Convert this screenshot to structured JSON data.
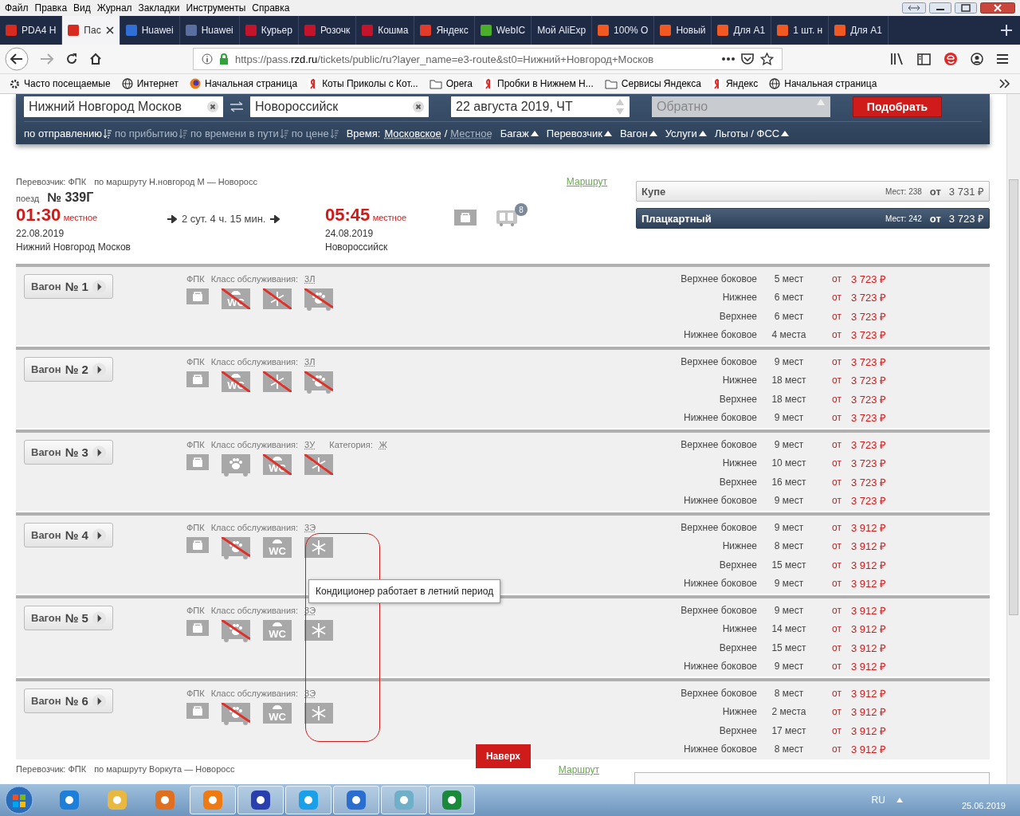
{
  "menu_bar": [
    "Файл",
    "Правка",
    "Вид",
    "Журнал",
    "Закладки",
    "Инструменты",
    "Справка"
  ],
  "tabs": [
    {
      "title": "PDA4 H",
      "selected": false,
      "color": "#d62b1e"
    },
    {
      "title": "Пас",
      "selected": true,
      "color": "#d62b1e"
    },
    {
      "title": "Huawei",
      "selected": false,
      "color": "#2f6fd6"
    },
    {
      "title": "Huawei",
      "selected": false,
      "color": "#5a6fa0"
    },
    {
      "title": "Курьер",
      "selected": false,
      "color": "#c4142b"
    },
    {
      "title": "Розочк",
      "selected": false,
      "color": "#c4142b"
    },
    {
      "title": "Кошма",
      "selected": false,
      "color": "#c4142b"
    },
    {
      "title": "Яндекс",
      "selected": false,
      "color": "#e23b2a"
    },
    {
      "title": "WebIC",
      "selected": false,
      "color": "#4caf2a"
    },
    {
      "title": "Мой AliExp",
      "selected": false
    },
    {
      "title": "100% O",
      "selected": false,
      "color": "#f05a22"
    },
    {
      "title": "Новый",
      "selected": false,
      "color": "#f05a22"
    },
    {
      "title": "Для A1",
      "selected": false,
      "color": "#f05a22"
    },
    {
      "title": "1 шт. н",
      "selected": false,
      "color": "#f05a22"
    },
    {
      "title": "Для A1",
      "selected": false,
      "color": "#f05a22"
    }
  ],
  "address": {
    "url_host": "https://pass.",
    "url_domain": "rzd.ru",
    "url_rest": "/tickets/public/ru?layer_name=e3-route&st0=Нижний+Новгород+Москов"
  },
  "bookmarks": [
    {
      "kind": "gear",
      "label": "Часто посещаемые"
    },
    {
      "kind": "globe",
      "label": "Интернет"
    },
    {
      "kind": "fox",
      "label": "Начальная страница"
    },
    {
      "kind": "ya",
      "label": "Коты Приколы с Кот..."
    },
    {
      "kind": "folder",
      "label": "Opera"
    },
    {
      "kind": "ya",
      "label": "Пробки в Нижнем Н..."
    },
    {
      "kind": "folder",
      "label": "Сервисы Яндекса"
    },
    {
      "kind": "ya",
      "label": "Яндекс"
    },
    {
      "kind": "globe",
      "label": "Начальная страница"
    }
  ],
  "search": {
    "from": "Нижний Новгород Москов",
    "to": "Новороссийск",
    "date": "22 августа 2019, ЧТ",
    "return_placeholder": "Обратно",
    "submit": "Подобрать"
  },
  "sort_options": [
    {
      "label": "по отправлению",
      "selected": true
    },
    {
      "label": "по прибытию",
      "selected": false
    },
    {
      "label": "по времени в пути",
      "selected": false
    },
    {
      "label": "по цене",
      "selected": false
    }
  ],
  "time_label": "Время:",
  "time_options": [
    {
      "label": "Московское",
      "selected": true
    },
    {
      "label": "Местное",
      "selected": false
    }
  ],
  "time_separator": "/",
  "filters": [
    "Багаж",
    "Перевозчик",
    "Вагон",
    "Услуги",
    "Льготы / ФСС"
  ],
  "train": {
    "carrier": "Перевозчик: ФПК",
    "route": "по маршруту Н.новгород М — Новоросс",
    "route_link": "Маршрут",
    "train_label": "поезд",
    "number": "№ 339Г",
    "departure": {
      "time": "01:30",
      "zone": "местное",
      "date": "22.08.2019",
      "station": "Нижний Новгород Москов"
    },
    "duration": "2 сут. 4 ч. 15 мин.",
    "arrival": {
      "time": "05:45",
      "zone": "местное",
      "date": "24.08.2019",
      "station": "Новороссийск"
    },
    "wagons_badge": "8",
    "classes": [
      {
        "name": "Купе",
        "seats": "Мест: 238",
        "from": "от",
        "price": "3 731 ₽",
        "selected": false
      },
      {
        "name": "Плацкартный",
        "seats": "Мест: 242",
        "from": "от",
        "price": "3 723 ₽",
        "selected": true
      }
    ]
  },
  "wagons": [
    {
      "label": "Вагон",
      "number": "№ 1",
      "carrier": "ФПК",
      "class_label": "Класс обслуживания:",
      "class_value": "3Л",
      "amenities": [
        {
          "kind": "baggage",
          "crossed": false
        },
        {
          "kind": "wc",
          "label": "WC",
          "crossed": true
        },
        {
          "kind": "snow",
          "crossed": true
        },
        {
          "kind": "pet",
          "crossed": true
        }
      ],
      "seats": [
        {
          "type": "Верхнее боковое",
          "count": "5 мест",
          "from": "от",
          "price": "3 723 ₽"
        },
        {
          "type": "Нижнее",
          "count": "6 мест",
          "from": "от",
          "price": "3 723 ₽"
        },
        {
          "type": "Верхнее",
          "count": "6 мест",
          "from": "от",
          "price": "3 723 ₽"
        },
        {
          "type": "Нижнее боковое",
          "count": "4 места",
          "from": "от",
          "price": "3 723 ₽"
        }
      ]
    },
    {
      "label": "Вагон",
      "number": "№ 2",
      "carrier": "ФПК",
      "class_label": "Класс обслуживания:",
      "class_value": "3Л",
      "amenities": [
        {
          "kind": "baggage",
          "crossed": false
        },
        {
          "kind": "wc",
          "label": "WC",
          "crossed": true
        },
        {
          "kind": "snow",
          "crossed": true
        },
        {
          "kind": "pet",
          "crossed": true
        }
      ],
      "seats": [
        {
          "type": "Верхнее боковое",
          "count": "9 мест",
          "from": "от",
          "price": "3 723 ₽"
        },
        {
          "type": "Нижнее",
          "count": "18 мест",
          "from": "от",
          "price": "3 723 ₽"
        },
        {
          "type": "Верхнее",
          "count": "18 мест",
          "from": "от",
          "price": "3 723 ₽"
        },
        {
          "type": "Нижнее боковое",
          "count": "9 мест",
          "from": "от",
          "price": "3 723 ₽"
        }
      ]
    },
    {
      "label": "Вагон",
      "number": "№ 3",
      "carrier": "ФПК",
      "class_label": "Класс обслуживания:",
      "class_value": "3У",
      "category_label": "Категория:",
      "category_value": "Ж",
      "amenities": [
        {
          "kind": "baggage",
          "crossed": false
        },
        {
          "kind": "pet",
          "crossed": false
        },
        {
          "kind": "wc",
          "label": "WC",
          "crossed": true
        },
        {
          "kind": "snow",
          "crossed": true
        }
      ],
      "seats": [
        {
          "type": "Верхнее боковое",
          "count": "9 мест",
          "from": "от",
          "price": "3 723 ₽"
        },
        {
          "type": "Нижнее",
          "count": "10 мест",
          "from": "от",
          "price": "3 723 ₽"
        },
        {
          "type": "Верхнее",
          "count": "16 мест",
          "from": "от",
          "price": "3 723 ₽"
        },
        {
          "type": "Нижнее боковое",
          "count": "9 мест",
          "from": "от",
          "price": "3 723 ₽"
        }
      ]
    },
    {
      "label": "Вагон",
      "number": "№ 4",
      "carrier": "ФПК",
      "class_label": "Класс обслуживания:",
      "class_value": "3Э",
      "amenities": [
        {
          "kind": "baggage",
          "crossed": false
        },
        {
          "kind": "pet",
          "crossed": true
        },
        {
          "kind": "wc",
          "label": "WC",
          "crossed": false
        },
        {
          "kind": "snow",
          "crossed": false
        }
      ],
      "seats": [
        {
          "type": "Верхнее боковое",
          "count": "9 мест",
          "from": "от",
          "price": "3 912 ₽"
        },
        {
          "type": "Нижнее",
          "count": "8 мест",
          "from": "от",
          "price": "3 912 ₽"
        },
        {
          "type": "Верхнее",
          "count": "15 мест",
          "from": "от",
          "price": "3 912 ₽"
        },
        {
          "type": "Нижнее боковое",
          "count": "9 мест",
          "from": "от",
          "price": "3 912 ₽"
        }
      ]
    },
    {
      "label": "Вагон",
      "number": "№ 5",
      "carrier": "ФПК",
      "class_label": "Класс обслуживания:",
      "class_value": "3Э",
      "amenities": [
        {
          "kind": "baggage",
          "crossed": false
        },
        {
          "kind": "pet",
          "crossed": true
        },
        {
          "kind": "wc",
          "label": "WC",
          "crossed": false
        },
        {
          "kind": "snow",
          "crossed": false
        }
      ],
      "seats": [
        {
          "type": "Верхнее боковое",
          "count": "9 мест",
          "from": "от",
          "price": "3 912 ₽"
        },
        {
          "type": "Нижнее",
          "count": "14 мест",
          "from": "от",
          "price": "3 912 ₽"
        },
        {
          "type": "Верхнее",
          "count": "15 мест",
          "from": "от",
          "price": "3 912 ₽"
        },
        {
          "type": "Нижнее боковое",
          "count": "9 мест",
          "from": "от",
          "price": "3 912 ₽"
        }
      ]
    },
    {
      "label": "Вагон",
      "number": "№ 6",
      "carrier": "ФПК",
      "class_label": "Класс обслуживания:",
      "class_value": "3Э",
      "amenities": [
        {
          "kind": "baggage",
          "crossed": false
        },
        {
          "kind": "pet",
          "crossed": true
        },
        {
          "kind": "wc",
          "label": "WC",
          "crossed": false
        },
        {
          "kind": "snow",
          "crossed": false
        }
      ],
      "seats": [
        {
          "type": "Верхнее боковое",
          "count": "8 мест",
          "from": "от",
          "price": "3 912 ₽"
        },
        {
          "type": "Нижнее",
          "count": "2 места",
          "from": "от",
          "price": "3 912 ₽"
        },
        {
          "type": "Верхнее",
          "count": "17 мест",
          "from": "от",
          "price": "3 912 ₽"
        },
        {
          "type": "Нижнее боковое",
          "count": "8 мест",
          "from": "от",
          "price": "3 912 ₽"
        }
      ]
    }
  ],
  "tooltip": "Кондиционер работает в летний период",
  "to_top": "Наверх",
  "next_train": {
    "carrier": "Перевозчик: ФПК",
    "route": "по маршруту Воркута — Новоросс",
    "route_link": "Маршрут"
  },
  "taskbar": {
    "apps": [
      {
        "color": "#1e7fd8",
        "open": false
      },
      {
        "color": "#e8b840",
        "open": false
      },
      {
        "color": "#e07020",
        "open": false
      },
      {
        "color": "#f07a12",
        "open": true
      },
      {
        "color": "#2a3fae",
        "open": true
      },
      {
        "color": "#1aa0e8",
        "open": true
      },
      {
        "color": "#2a6fd0",
        "open": true
      },
      {
        "color": "#6fb0c8",
        "open": true
      },
      {
        "color": "#1a8a3a",
        "open": true
      }
    ],
    "language": "RU",
    "date": "25.06.2019"
  }
}
